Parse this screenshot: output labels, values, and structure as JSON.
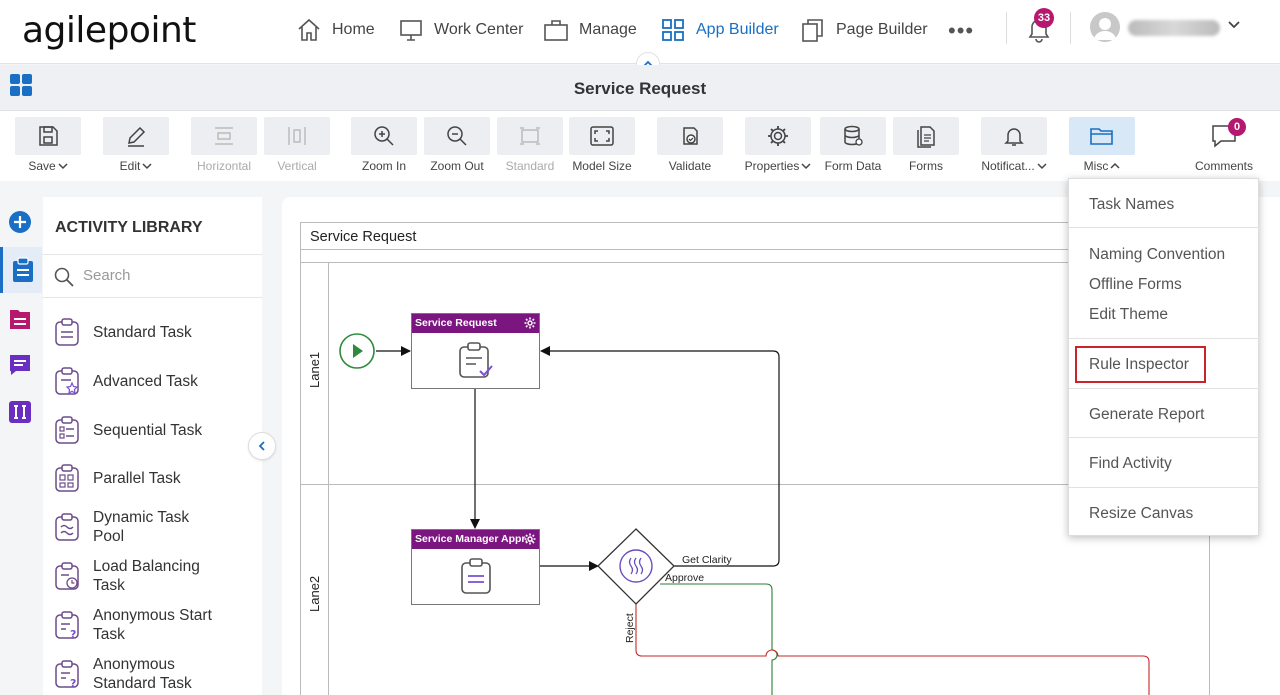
{
  "brand": {
    "logo_text": "agilepoint"
  },
  "nav": {
    "items": [
      {
        "label": "Home",
        "icon": "home-icon",
        "active": false
      },
      {
        "label": "Work Center",
        "icon": "monitor-icon",
        "active": false
      },
      {
        "label": "Manage",
        "icon": "briefcase-icon",
        "active": false
      },
      {
        "label": "App Builder",
        "icon": "app-grid-icon",
        "active": true
      },
      {
        "label": "Page Builder",
        "icon": "pages-icon",
        "active": false
      }
    ],
    "more": "•••",
    "notifications_count": "33"
  },
  "header": {
    "title": "Service Request"
  },
  "toolbar": {
    "save": "Save",
    "edit": "Edit",
    "horizontal": "Horizontal",
    "vertical": "Vertical",
    "zoom_in": "Zoom In",
    "zoom_out": "Zoom Out",
    "standard": "Standard",
    "model_size": "Model Size",
    "validate": "Validate",
    "properties": "Properties",
    "form_data": "Form Data",
    "forms": "Forms",
    "notifications": "Notificat...",
    "misc": "Misc",
    "comments": "Comments",
    "comments_count": "0"
  },
  "library": {
    "title": "ACTIVITY LIBRARY",
    "search_placeholder": "Search",
    "items": [
      {
        "label": "Standard Task"
      },
      {
        "label": "Advanced Task"
      },
      {
        "label": "Sequential Task"
      },
      {
        "label": "Parallel Task"
      },
      {
        "label": "Dynamic Task Pool"
      },
      {
        "label": "Load Balancing Task"
      },
      {
        "label": "Anonymous Start Task"
      },
      {
        "label": "Anonymous Standard Task"
      }
    ]
  },
  "canvas": {
    "pool_title": "Service Request",
    "lanes": [
      "Lane1",
      "Lane2"
    ],
    "tasks": [
      {
        "title": "Service Request"
      },
      {
        "title": "Service Manager Appr..."
      }
    ],
    "flow_labels": {
      "get_clarity": "Get Clarity",
      "approve": "Approve",
      "reject": "Reject"
    }
  },
  "misc_menu": {
    "items": [
      "Task Names",
      "Naming Convention",
      "Offline Forms",
      "Edit Theme",
      "Rule Inspector",
      "Generate Report",
      "Find Activity",
      "Resize Canvas"
    ],
    "highlighted": "Rule Inspector"
  },
  "colors": {
    "accent": "#1a6fc4",
    "task_header": "#7b1680",
    "badge": "#b5186e",
    "approve_line": "#2e7d32",
    "reject_line": "#c62828",
    "highlight_border": "#c8242b"
  }
}
